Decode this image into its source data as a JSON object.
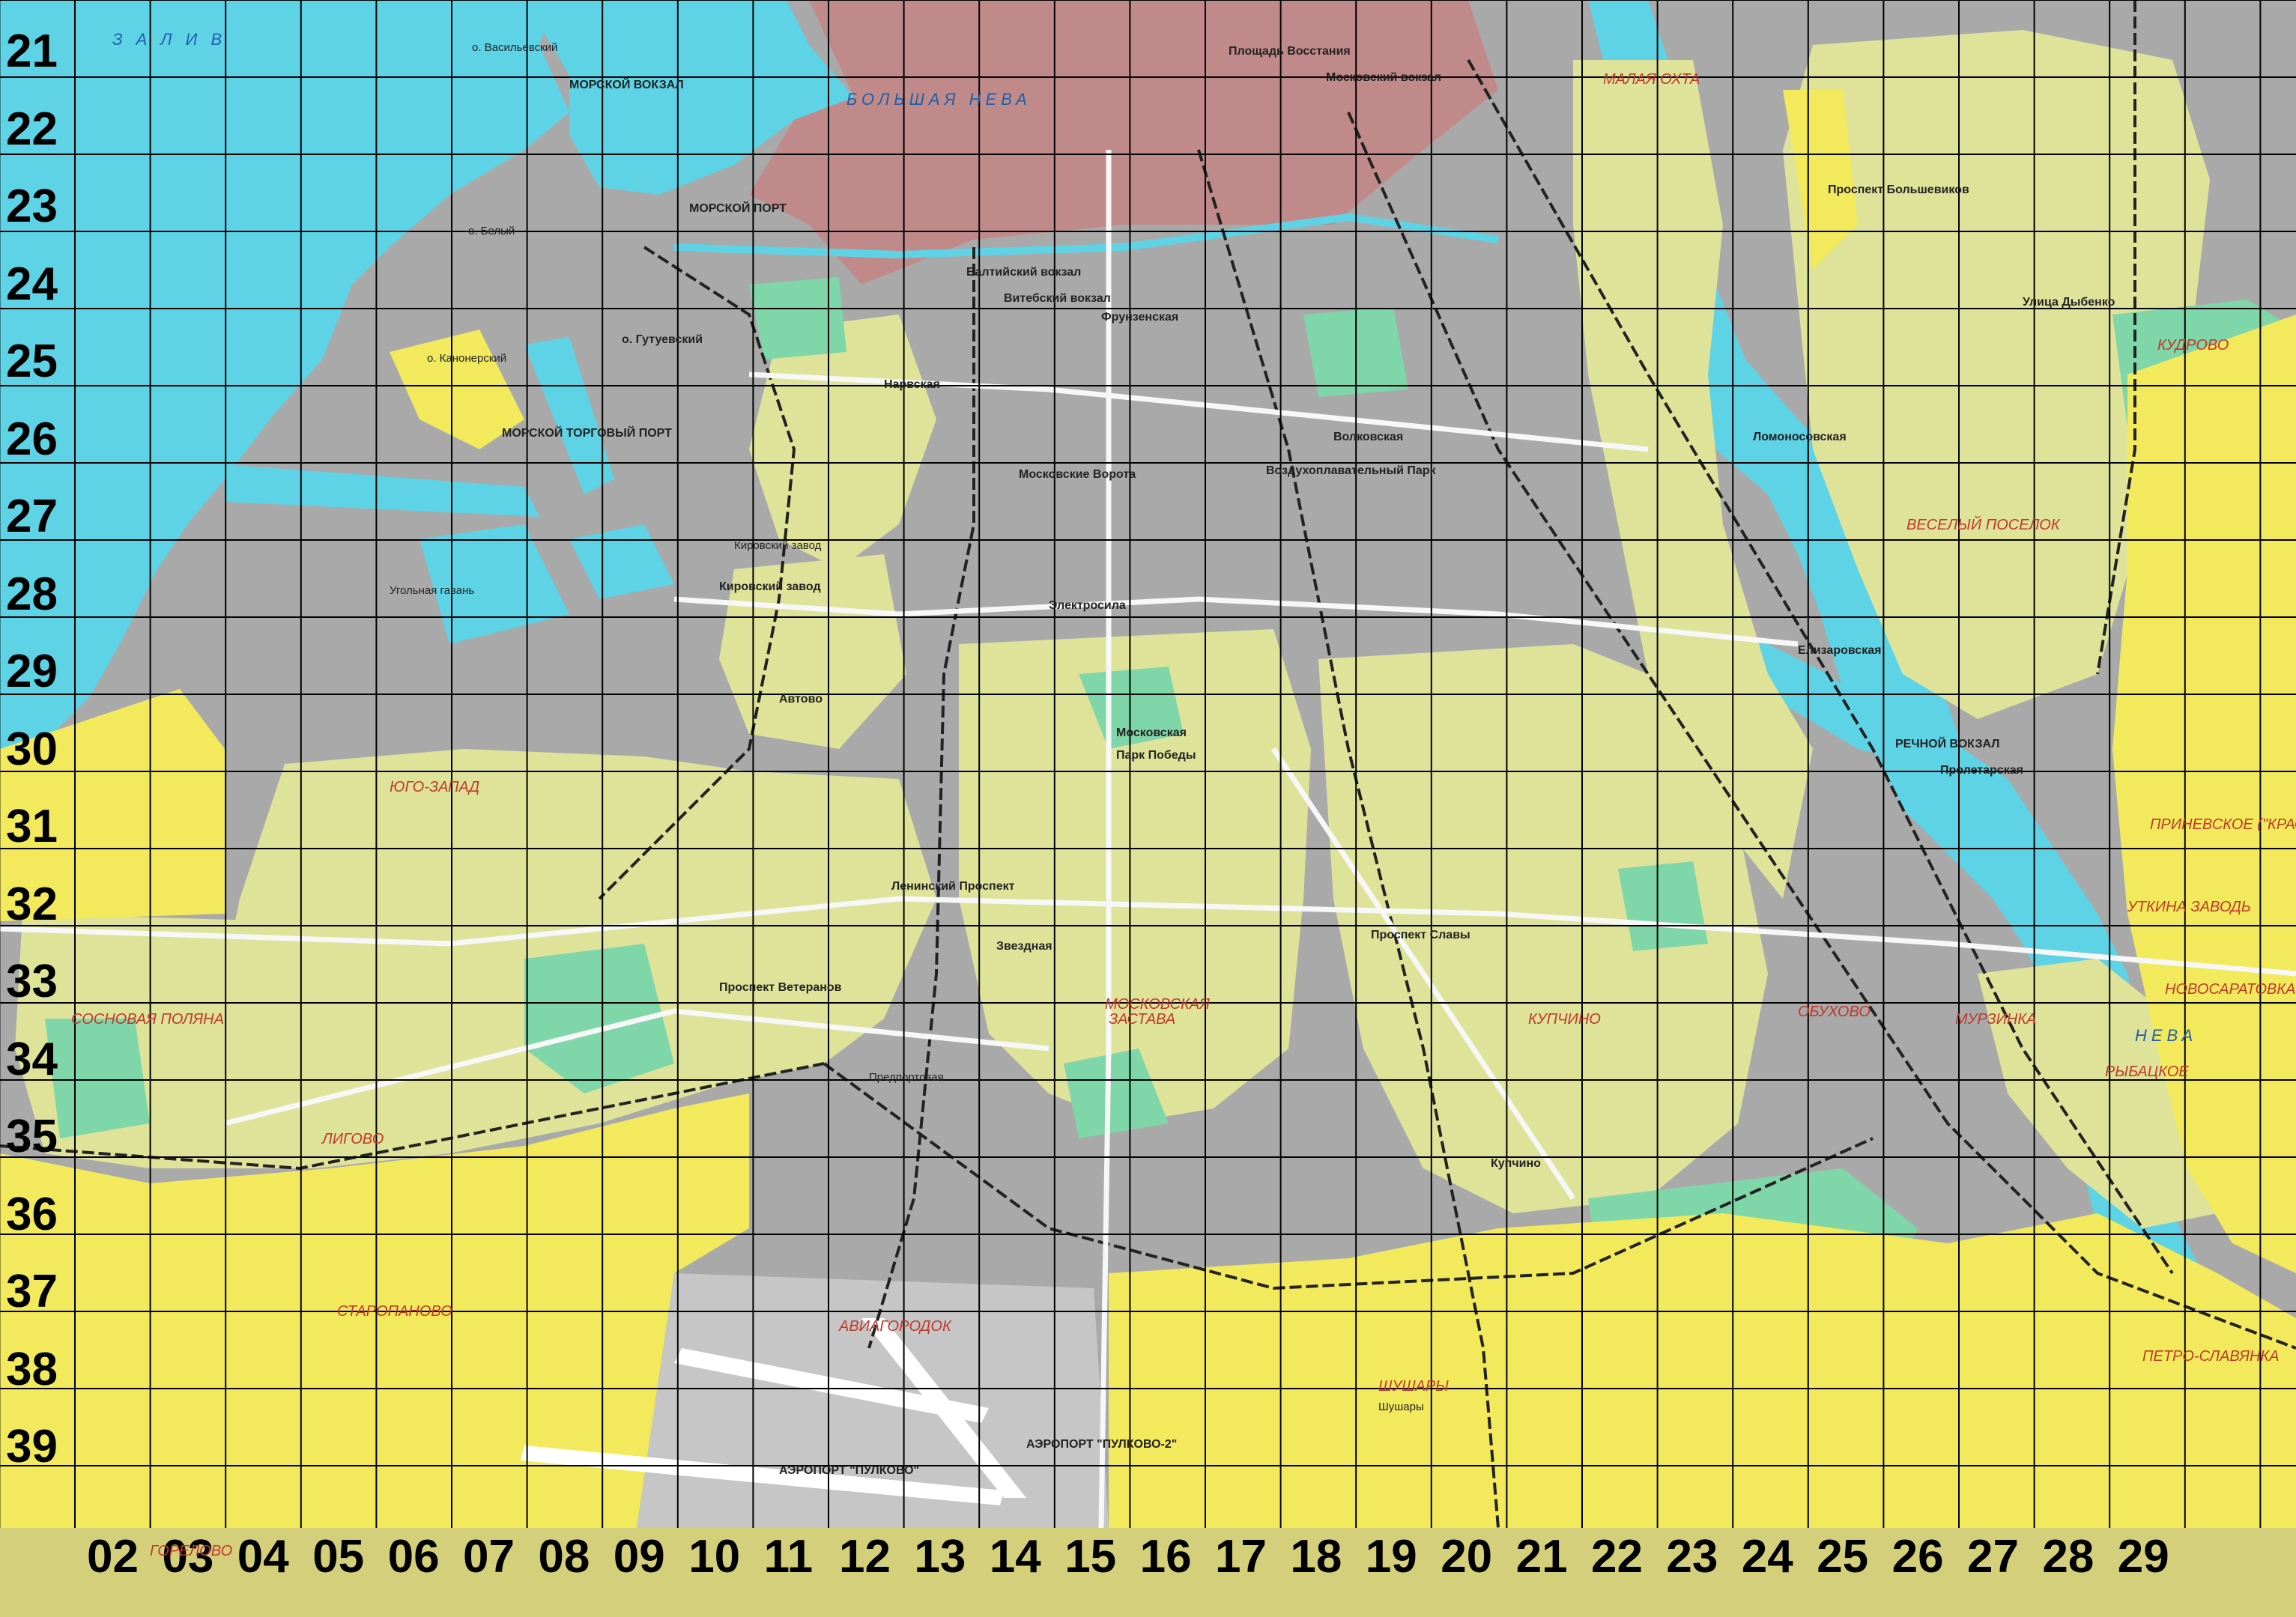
{
  "colors": {
    "water": "#5ed3e6",
    "urban": "#a9a9a9",
    "center": "#c08a8a",
    "residential": "#dfe39a",
    "green": "#7fd6a8",
    "suburb": "#f2ea5c",
    "building": "#8a5a1c",
    "grid": "#000000"
  },
  "grid": {
    "rows": [
      "21",
      "22",
      "23",
      "24",
      "25",
      "26",
      "27",
      "28",
      "29",
      "30",
      "31",
      "32",
      "33",
      "34",
      "35",
      "36",
      "37",
      "38",
      "39"
    ],
    "cols": [
      "02",
      "03",
      "04",
      "05",
      "06",
      "07",
      "08",
      "09",
      "10",
      "11",
      "12",
      "13",
      "14",
      "15",
      "16",
      "17",
      "18",
      "19",
      "20",
      "21",
      "22",
      "23",
      "24",
      "25",
      "26",
      "27",
      "28",
      "29"
    ]
  },
  "places": [
    {
      "text": "З А Л И В",
      "kind": "water"
    },
    {
      "text": "о. Васильевский",
      "kind": "label"
    },
    {
      "text": "МОРСКОЙ ВОКЗАЛ",
      "kind": "big"
    },
    {
      "text": "МОРСКОЙ ПОРТ",
      "kind": "big"
    },
    {
      "text": "о. Белый",
      "kind": "label"
    },
    {
      "text": "о. Гутуевский",
      "kind": "big"
    },
    {
      "text": "о. Канонерский",
      "kind": "label"
    },
    {
      "text": "МОРСКОЙ ТОРГОВЫЙ ПОРТ",
      "kind": "big"
    },
    {
      "text": "Кировский завод",
      "kind": "label"
    },
    {
      "text": "Угольная гавань",
      "kind": "label"
    },
    {
      "text": "ЮГО-ЗАПАД",
      "kind": "district"
    },
    {
      "text": "СОСНОВАЯ ПОЛЯНА",
      "kind": "district"
    },
    {
      "text": "ЛИГОВО",
      "kind": "district"
    },
    {
      "text": "СТАРОПАНОВО",
      "kind": "district"
    },
    {
      "text": "ГОРЕЛОВО",
      "kind": "district"
    },
    {
      "text": "АВИАГОРОДОК",
      "kind": "district"
    },
    {
      "text": "АЭРОПОРТ \"ПУЛКОВО\"",
      "kind": "big"
    },
    {
      "text": "АЭРОПОРТ \"ПУЛКОВО-2\"",
      "kind": "big"
    },
    {
      "text": "Предпортовая",
      "kind": "label"
    },
    {
      "text": "МОСКОВСКАЯ",
      "kind": "district"
    },
    {
      "text": "ЗАСТАВА",
      "kind": "district"
    },
    {
      "text": "Парк Победы",
      "kind": "big"
    },
    {
      "text": "Московские Ворота",
      "kind": "big"
    },
    {
      "text": "Электросила",
      "kind": "big"
    },
    {
      "text": "Московская",
      "kind": "big"
    },
    {
      "text": "КУПЧИНО",
      "kind": "district"
    },
    {
      "text": "ОБУХОВО",
      "kind": "district"
    },
    {
      "text": "Купчино",
      "kind": "big"
    },
    {
      "text": "Шушары",
      "kind": "label"
    },
    {
      "text": "ШУШАРЫ",
      "kind": "district"
    },
    {
      "text": "НЕВА",
      "kind": "water"
    },
    {
      "text": "РЕЧНОЙ ВОКЗАЛ",
      "kind": "big"
    },
    {
      "text": "Пролетарская",
      "kind": "big"
    },
    {
      "text": "МУРЗИНКА",
      "kind": "district"
    },
    {
      "text": "РЫБАЦКОЕ",
      "kind": "district"
    },
    {
      "text": "ВЕСЕЛЫЙ ПОСЕЛОК",
      "kind": "district"
    },
    {
      "text": "КУДРОВО",
      "kind": "district"
    },
    {
      "text": "ПРИНЕВСКОЕ (\"КРАСНЫЙ ОКТЯБРЬ\")",
      "kind": "district"
    },
    {
      "text": "УТКИНА ЗАВОДЬ",
      "kind": "district"
    },
    {
      "text": "НОВОСАРАТОВКА",
      "kind": "district"
    },
    {
      "text": "ПЕТРО-СЛАВЯНКА",
      "kind": "district"
    },
    {
      "text": "МАЛАЯ ОХТА",
      "kind": "district"
    },
    {
      "text": "Проспект Большевиков",
      "kind": "big"
    },
    {
      "text": "Улица Дыбенко",
      "kind": "big"
    },
    {
      "text": "Ломоносовская",
      "kind": "big"
    },
    {
      "text": "Балтийский вокзал",
      "kind": "big"
    },
    {
      "text": "Витебский вокзал",
      "kind": "big"
    },
    {
      "text": "Московский вокзал",
      "kind": "big"
    },
    {
      "text": "Площадь Восстания",
      "kind": "big"
    },
    {
      "text": "Фрунзенская",
      "kind": "big"
    },
    {
      "text": "Нарвская",
      "kind": "big"
    },
    {
      "text": "Кировский завод",
      "kind": "big"
    },
    {
      "text": "Автово",
      "kind": "big"
    },
    {
      "text": "Проспект Ветеранов",
      "kind": "big"
    },
    {
      "text": "Ленинский Проспект",
      "kind": "big"
    },
    {
      "text": "Звездная",
      "kind": "big"
    },
    {
      "text": "Проспект Славы",
      "kind": "big"
    },
    {
      "text": "Воздухоплавательный Парк",
      "kind": "big"
    },
    {
      "text": "БОЛЬШАЯ НЕВА",
      "kind": "water"
    },
    {
      "text": "Волковская",
      "kind": "big"
    },
    {
      "text": "Елизаровская",
      "kind": "big"
    }
  ]
}
